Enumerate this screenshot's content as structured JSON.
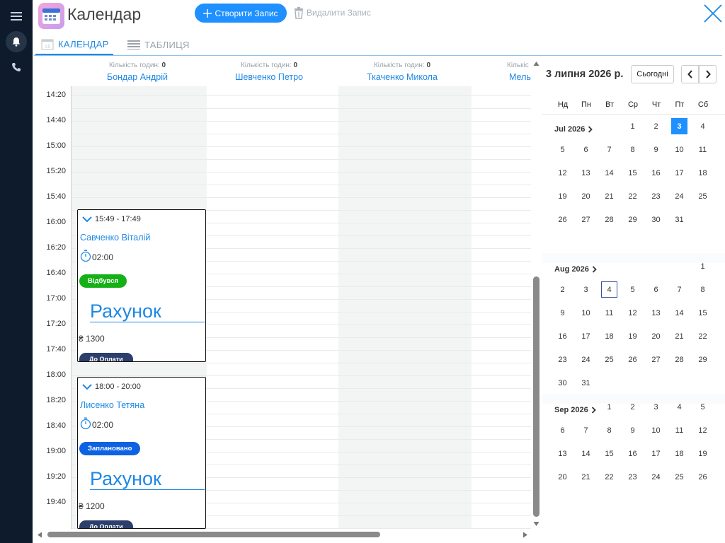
{
  "app": {
    "title": "Календар"
  },
  "toolbar": {
    "create_label": "Створити Запис",
    "delete_label": "Видалити Запис"
  },
  "tabs": [
    {
      "label": "КАЛЕНДАР",
      "active": true
    },
    {
      "label": "ТАБЛИЦЯ",
      "active": false
    }
  ],
  "icons": {
    "menu": "hamburger-icon",
    "notifications": "bell-icon",
    "phone": "phone-icon",
    "close": "close-icon",
    "clock": "stopwatch-icon",
    "chevron": "chevron-down-icon"
  },
  "colors": {
    "accent": "#1e90ff",
    "rail": "#0e1b2c",
    "status_done": "#15b016",
    "status_planned": "#0d62e3",
    "pay_badge": "#2c3e6b"
  },
  "resources": [
    {
      "hours_label": "Кількість годин:",
      "hours": "0",
      "name": "Бондар Андрій"
    },
    {
      "hours_label": "Кількість годин:",
      "hours": "0",
      "name": "Шевченко Петро"
    },
    {
      "hours_label": "Кількість годин:",
      "hours": "0",
      "name": "Ткаченко Микола"
    },
    {
      "hours_label": "Кількіс",
      "hours": "",
      "name": "Мель"
    }
  ],
  "times": [
    "14:20",
    "14:40",
    "15:00",
    "15:20",
    "15:40",
    "16:00",
    "16:20",
    "16:40",
    "17:00",
    "17:20",
    "17:40",
    "18:00",
    "18:20",
    "18:40",
    "19:00",
    "19:20",
    "19:40"
  ],
  "events": [
    {
      "time": "15:49 - 17:49",
      "client": "Савченко Віталій",
      "duration": "02:00",
      "status": "Відбувся",
      "status_color": "#15b016",
      "invoice": "Рахунок",
      "amount": "₴ 1300",
      "payment": "До Оплати"
    },
    {
      "time": "18:00 - 20:00",
      "client": "Лисенко Тетяна",
      "duration": "02:00",
      "status": "Заплановано",
      "status_color": "#0d62e3",
      "invoice": "Рахунок",
      "amount": "₴ 1200",
      "payment": "До Оплати"
    }
  ],
  "sidebar": {
    "date": "3 липня 2026 р.",
    "today_label": "Сьогодні",
    "weekdays": [
      "Нд",
      "Пн",
      "Вт",
      "Ср",
      "Чт",
      "Пт",
      "Сб"
    ],
    "months": [
      {
        "label": "Jul 2026",
        "first_weekday": 3,
        "days": 31,
        "selected": 3,
        "today": null
      },
      {
        "label": "Aug 2026",
        "first_weekday": 6,
        "days": 31,
        "selected": null,
        "today": 4
      },
      {
        "label": "Sep 2026",
        "first_weekday": 2,
        "days": 26,
        "selected": null,
        "today": null
      }
    ]
  }
}
